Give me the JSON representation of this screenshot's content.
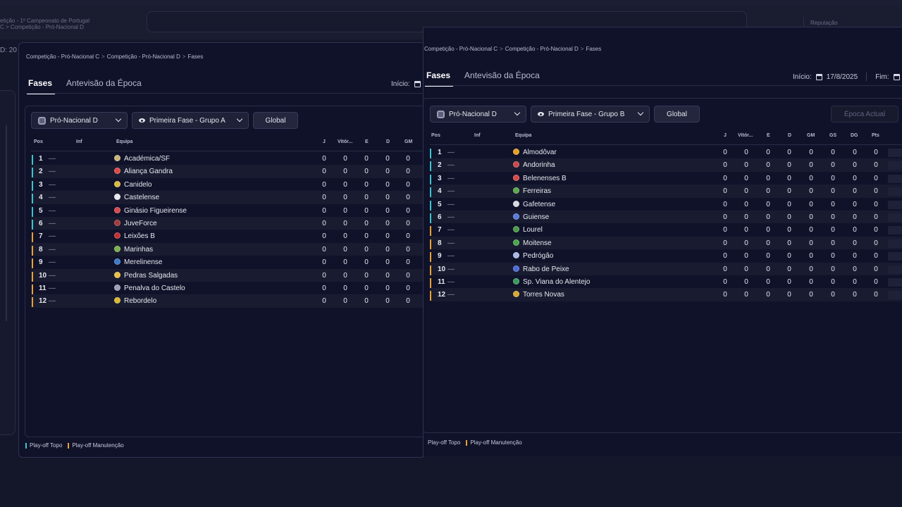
{
  "background": {
    "breadcrumb_line1": "etição - 1º Campeonato de Portugal",
    "breadcrumb_line2": "C > Competição - Pró-Nacional D",
    "reputation_label": "Reputação",
    "id_text": "D: 20"
  },
  "panel_a": {
    "breadcrumb": [
      "Competição - Pró-Nacional C",
      "Competição - Pró-Nacional D",
      "Fases"
    ],
    "tabs": [
      "Fases",
      "Antevisão da Época"
    ],
    "start_label": "Início:",
    "competition": "Pró-Nacional D",
    "phase": "Primeira Fase - Grupo A",
    "global_label": "Global",
    "headers": {
      "pos": "Pos",
      "inf": "Inf",
      "team": "Equipa",
      "j": "J",
      "w": "Vitór...",
      "e": "E",
      "d": "D",
      "gm": "GM"
    },
    "rows": [
      {
        "pos": "1",
        "team": "Académica/SF",
        "j": "0",
        "w": "0",
        "e": "0",
        "d": "0",
        "gm": "0"
      },
      {
        "pos": "2",
        "team": "Aliança Gandra",
        "j": "0",
        "w": "0",
        "e": "0",
        "d": "0",
        "gm": "0"
      },
      {
        "pos": "3",
        "team": "Canidelo",
        "j": "0",
        "w": "0",
        "e": "0",
        "d": "0",
        "gm": "0"
      },
      {
        "pos": "4",
        "team": "Castelense",
        "j": "0",
        "w": "0",
        "e": "0",
        "d": "0",
        "gm": "0"
      },
      {
        "pos": "5",
        "team": "Ginásio Figueirense",
        "j": "0",
        "w": "0",
        "e": "0",
        "d": "0",
        "gm": "0"
      },
      {
        "pos": "6",
        "team": "JuveForce",
        "j": "0",
        "w": "0",
        "e": "0",
        "d": "0",
        "gm": "0"
      },
      {
        "pos": "7",
        "team": "Leixões B",
        "j": "0",
        "w": "0",
        "e": "0",
        "d": "0",
        "gm": "0"
      },
      {
        "pos": "8",
        "team": "Marinhas",
        "j": "0",
        "w": "0",
        "e": "0",
        "d": "0",
        "gm": "0"
      },
      {
        "pos": "9",
        "team": "Merelinense",
        "j": "0",
        "w": "0",
        "e": "0",
        "d": "0",
        "gm": "0"
      },
      {
        "pos": "10",
        "team": "Pedras Salgadas",
        "j": "0",
        "w": "0",
        "e": "0",
        "d": "0",
        "gm": "0"
      },
      {
        "pos": "11",
        "team": "Penalva do Castelo",
        "j": "0",
        "w": "0",
        "e": "0",
        "d": "0",
        "gm": "0"
      },
      {
        "pos": "12",
        "team": "Rebordelo",
        "j": "0",
        "w": "0",
        "e": "0",
        "d": "0",
        "gm": "0"
      }
    ],
    "legend_top": "Play-off Topo",
    "legend_man": "Play-off Manutenção"
  },
  "panel_b": {
    "breadcrumb": [
      "Competição - Pró-Nacional C",
      "Competição - Pró-Nacional D",
      "Fases"
    ],
    "tabs": [
      "Fases",
      "Antevisão da Época"
    ],
    "start_label": "Início:",
    "start_date": "17/8/2025",
    "end_label": "Fim:",
    "competition": "Pró-Nacional D",
    "phase": "Primeira Fase - Grupo B",
    "global_label": "Global",
    "current_season_label": "Época Actual",
    "headers": {
      "pos": "Pos",
      "inf": "Inf",
      "team": "Equipa",
      "j": "J",
      "w": "Vitór...",
      "e": "E",
      "d": "D",
      "gm": "GM",
      "gs": "GS",
      "dg": "DG",
      "pts": "Pts"
    },
    "rows": [
      {
        "pos": "1",
        "team": "Almodôvar",
        "j": "0",
        "w": "0",
        "e": "0",
        "d": "0",
        "gm": "0",
        "gs": "0",
        "dg": "0",
        "pts": "0"
      },
      {
        "pos": "2",
        "team": "Andorinha",
        "j": "0",
        "w": "0",
        "e": "0",
        "d": "0",
        "gm": "0",
        "gs": "0",
        "dg": "0",
        "pts": "0"
      },
      {
        "pos": "3",
        "team": "Belenenses B",
        "j": "0",
        "w": "0",
        "e": "0",
        "d": "0",
        "gm": "0",
        "gs": "0",
        "dg": "0",
        "pts": "0"
      },
      {
        "pos": "4",
        "team": "Ferreiras",
        "j": "0",
        "w": "0",
        "e": "0",
        "d": "0",
        "gm": "0",
        "gs": "0",
        "dg": "0",
        "pts": "0"
      },
      {
        "pos": "5",
        "team": "Gafetense",
        "j": "0",
        "w": "0",
        "e": "0",
        "d": "0",
        "gm": "0",
        "gs": "0",
        "dg": "0",
        "pts": "0"
      },
      {
        "pos": "6",
        "team": "Guiense",
        "j": "0",
        "w": "0",
        "e": "0",
        "d": "0",
        "gm": "0",
        "gs": "0",
        "dg": "0",
        "pts": "0"
      },
      {
        "pos": "7",
        "team": "Lourel",
        "j": "0",
        "w": "0",
        "e": "0",
        "d": "0",
        "gm": "0",
        "gs": "0",
        "dg": "0",
        "pts": "0"
      },
      {
        "pos": "8",
        "team": "Moitense",
        "j": "0",
        "w": "0",
        "e": "0",
        "d": "0",
        "gm": "0",
        "gs": "0",
        "dg": "0",
        "pts": "0"
      },
      {
        "pos": "9",
        "team": "Pedrógão",
        "j": "0",
        "w": "0",
        "e": "0",
        "d": "0",
        "gm": "0",
        "gs": "0",
        "dg": "0",
        "pts": "0"
      },
      {
        "pos": "10",
        "team": "Rabo de Peixe",
        "j": "0",
        "w": "0",
        "e": "0",
        "d": "0",
        "gm": "0",
        "gs": "0",
        "dg": "0",
        "pts": "0"
      },
      {
        "pos": "11",
        "team": "Sp. Viana do Alentejo",
        "j": "0",
        "w": "0",
        "e": "0",
        "d": "0",
        "gm": "0",
        "gs": "0",
        "dg": "0",
        "pts": "0"
      },
      {
        "pos": "12",
        "team": "Torres Novas",
        "j": "0",
        "w": "0",
        "e": "0",
        "d": "0",
        "gm": "0",
        "gs": "0",
        "dg": "0",
        "pts": "0"
      }
    ],
    "legend_top": "Play-off Topo",
    "legend_man": "Play-off Manutenção"
  },
  "colors": {
    "playoff_top": "#3cc4cc",
    "playoff_relegation": "#e8a230"
  }
}
